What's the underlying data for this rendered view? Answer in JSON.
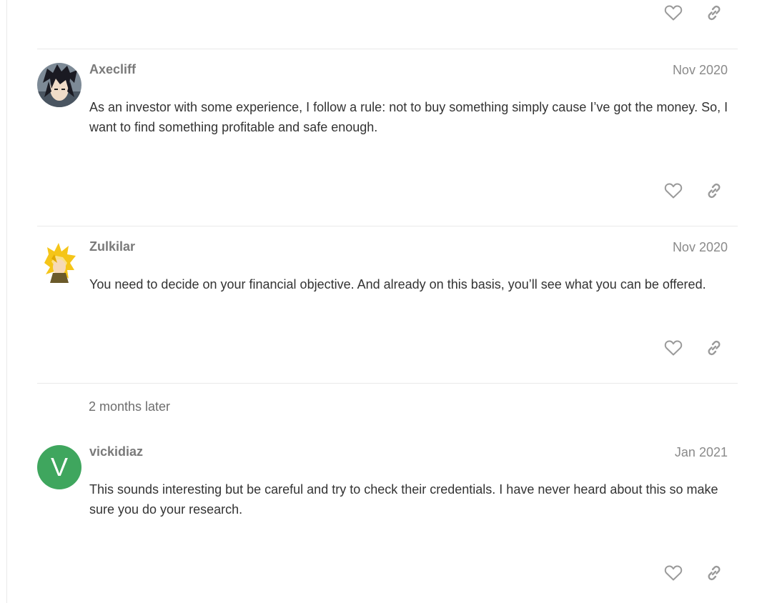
{
  "posts": [
    {
      "username": "Axecliff",
      "date": "Nov 2020",
      "body": "As an investor with some experience, I follow a rule: not to buy something simply cause I’ve got the money. So, I want to find something profitable and safe enough.",
      "avatar": "anime-character-dark-hair"
    },
    {
      "username": "Zulkilar",
      "date": "Nov 2020",
      "body": "You need to decide on your financial objective. And already on this basis, you’ll see what you can be offered.",
      "avatar": "anime-character-blonde-hair"
    },
    {
      "username": "vickidiaz",
      "date": "Jan 2021",
      "body": "This sounds interesting but be careful and try to check their credentials. I have never heard about this so make sure you do your research.",
      "avatar_letter": "V",
      "avatar_color": "#3fa65e"
    }
  ],
  "time_gap": "2 months later",
  "icons": {
    "like": "heart-icon",
    "share": "link-icon"
  },
  "colors": {
    "icon": "#9a9a9a",
    "divider": "#e9e9e9",
    "username": "#7a7a7a"
  }
}
